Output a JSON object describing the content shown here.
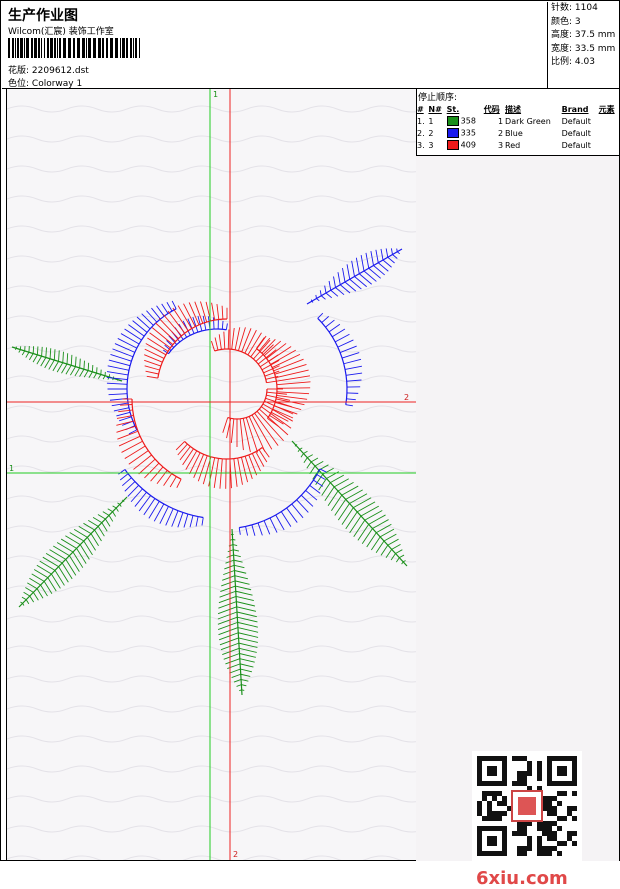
{
  "header": {
    "title": "生产作业图",
    "subtitle": "Wilcom(汇宸) 装饰工作室",
    "design_label": "花版:",
    "design_value": "2209612.dst",
    "colorway_label": "色位:",
    "colorway_value": "Colorway 1"
  },
  "stats": {
    "stitches": "针数: 1104",
    "colors": "颜色: 3",
    "height": "高度: 37.5 mm",
    "width": "宽度: 33.5 mm",
    "scale": "比例: 4.03"
  },
  "stop_sequence": {
    "title": "停止顺序:",
    "headers": [
      "#",
      "N#",
      "St.",
      "代码",
      "描述",
      "Brand",
      "元素"
    ],
    "rows": [
      {
        "idx": "1.",
        "n": "1",
        "st": "358",
        "code": "1",
        "desc": "Dark Green",
        "brand": "Default",
        "color": "#1a8f1a"
      },
      {
        "idx": "2.",
        "n": "2",
        "st": "335",
        "code": "2",
        "desc": "Blue",
        "brand": "Default",
        "color": "#1a1aee"
      },
      {
        "idx": "3.",
        "n": "3",
        "st": "409",
        "code": "3",
        "desc": "Red",
        "brand": "Default",
        "color": "#ee1a1a"
      }
    ]
  },
  "axes": {
    "green_v_label": "1",
    "green_h_label": "1",
    "red_v_label": "2",
    "red_h_label": "2"
  },
  "watermark": {
    "text": "6xiu.com"
  },
  "colors": {
    "green": "#1a8f1a",
    "blue": "#1a1aee",
    "red": "#ee1a1a",
    "guide_green": "#22cc22",
    "guide_red": "#ee2222"
  }
}
